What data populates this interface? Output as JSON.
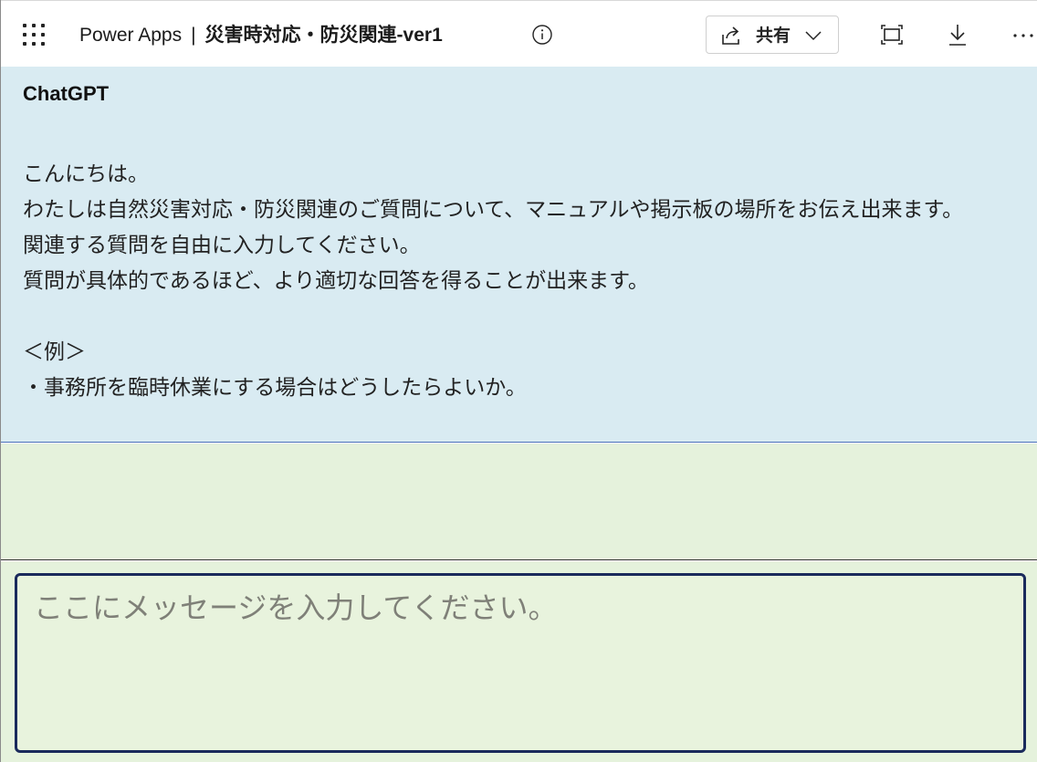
{
  "header": {
    "product": "Power Apps",
    "separator": "|",
    "app_name": "災害時対応・防災関連-ver1",
    "share_label": "共有",
    "icons": [
      "app-launcher-icon",
      "info-icon",
      "share-icon",
      "chevron-down-icon",
      "fit-to-screen-icon",
      "download-icon",
      "more-icon"
    ]
  },
  "bot_message": {
    "sender": "ChatGPT",
    "body": "こんにちは。\nわたしは自然災害対応・防災関連のご質問について、マニュアルや掲示板の場所をお伝え出来ます。\n関連する質問を自由に入力してください。\n質問が具体的であるほど、より適切な回答を得ることが出来ます。\n\n＜例＞\n・事務所を臨時休業にする場合はどうしたらよいか。"
  },
  "input": {
    "placeholder": "ここにメッセージを入力してください。",
    "value": ""
  },
  "colors": {
    "bot_background": "#d9ebf2",
    "chat_background": "#e5f2dc",
    "input_border": "#1a2a5c"
  }
}
